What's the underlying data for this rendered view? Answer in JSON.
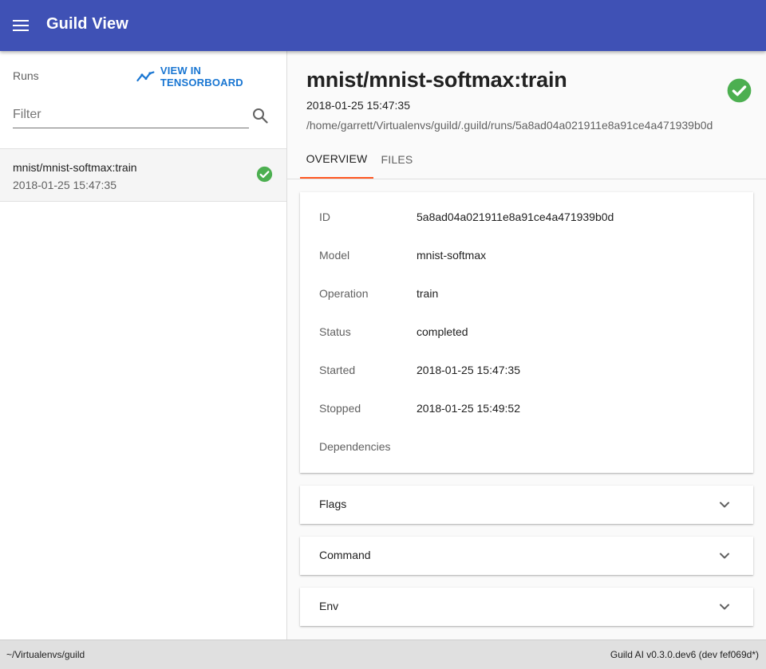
{
  "app": {
    "title": "Guild View",
    "menu_icon": "menu-icon",
    "accent": "#3f51b5"
  },
  "sidebar": {
    "runs_label": "Runs",
    "tensorboard_label": "VIEW IN TENSORBOARD",
    "tensorboard_icon": "timeline-icon",
    "filter": {
      "placeholder": "Filter",
      "value": ""
    },
    "search_icon": "search-icon",
    "runs": [
      {
        "name": "mnist/mnist-softmax:train",
        "date": "2018-01-25 15:47:35",
        "status_icon": "check-circle-icon",
        "status_color": "#4caf50"
      }
    ]
  },
  "run": {
    "title": "mnist/mnist-softmax:train",
    "started": "2018-01-25 15:47:35",
    "path": "/home/garrett/Virtualenvs/guild/.guild/runs/5a8ad04a021911e8a91ce4a471939b0d",
    "status_icon": "check-circle-icon",
    "status_color": "#4caf50"
  },
  "tabs": [
    {
      "label": "OVERVIEW",
      "active": true
    },
    {
      "label": "FILES",
      "active": false
    }
  ],
  "overview": [
    {
      "key": "ID",
      "value": "5a8ad04a021911e8a91ce4a471939b0d"
    },
    {
      "key": "Model",
      "value": "mnist-softmax"
    },
    {
      "key": "Operation",
      "value": "train"
    },
    {
      "key": "Status",
      "value": "completed"
    },
    {
      "key": "Started",
      "value": "2018-01-25 15:47:35"
    },
    {
      "key": "Stopped",
      "value": "2018-01-25 15:49:52"
    },
    {
      "key": "Dependencies",
      "value": ""
    }
  ],
  "panels": [
    {
      "title": "Flags",
      "icon": "chevron-down-icon"
    },
    {
      "title": "Command",
      "icon": "chevron-down-icon"
    },
    {
      "title": "Env",
      "icon": "chevron-down-icon"
    }
  ],
  "footer": {
    "left": "~/Virtualenvs/guild",
    "right": "Guild AI v0.3.0.dev6 (dev fef069d*)"
  },
  "colors": {
    "tab_indicator": "#ff5722",
    "link": "#1976d2",
    "success": "#4caf50"
  }
}
